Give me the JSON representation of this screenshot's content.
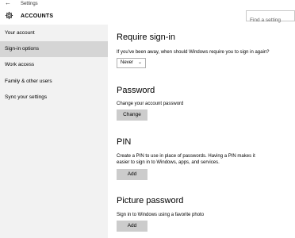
{
  "window": {
    "title": "Settings",
    "back_icon": "back-arrow-icon"
  },
  "header": {
    "title": "ACCOUNTS",
    "icon": "gear-icon"
  },
  "search": {
    "placeholder": "Find a setting"
  },
  "sidebar": {
    "items": [
      {
        "label": "Your account",
        "active": false
      },
      {
        "label": "Sign-in options",
        "active": true
      },
      {
        "label": "Work access",
        "active": false
      },
      {
        "label": "Family & other users",
        "active": false
      },
      {
        "label": "Sync your settings",
        "active": false
      }
    ]
  },
  "main": {
    "require_signin": {
      "title": "Require sign-in",
      "question": "If you've been away, when should Windows require you to sign in again?",
      "selected": "Never"
    },
    "password": {
      "title": "Password",
      "description": "Change your account password",
      "button": "Change"
    },
    "pin": {
      "title": "PIN",
      "description_line1": "Create a PIN to use in place of passwords. Having a PIN makes it",
      "description_line2": "easier to sign in to Windows, apps, and services.",
      "button": "Add"
    },
    "picture_password": {
      "title": "Picture password",
      "description": "Sign in to Windows using a favorite photo",
      "button": "Add"
    }
  },
  "colors": {
    "sidebar_bg": "#f2f2f2",
    "active_item_bg": "#d5d5d5",
    "button_bg": "#cccccc"
  }
}
